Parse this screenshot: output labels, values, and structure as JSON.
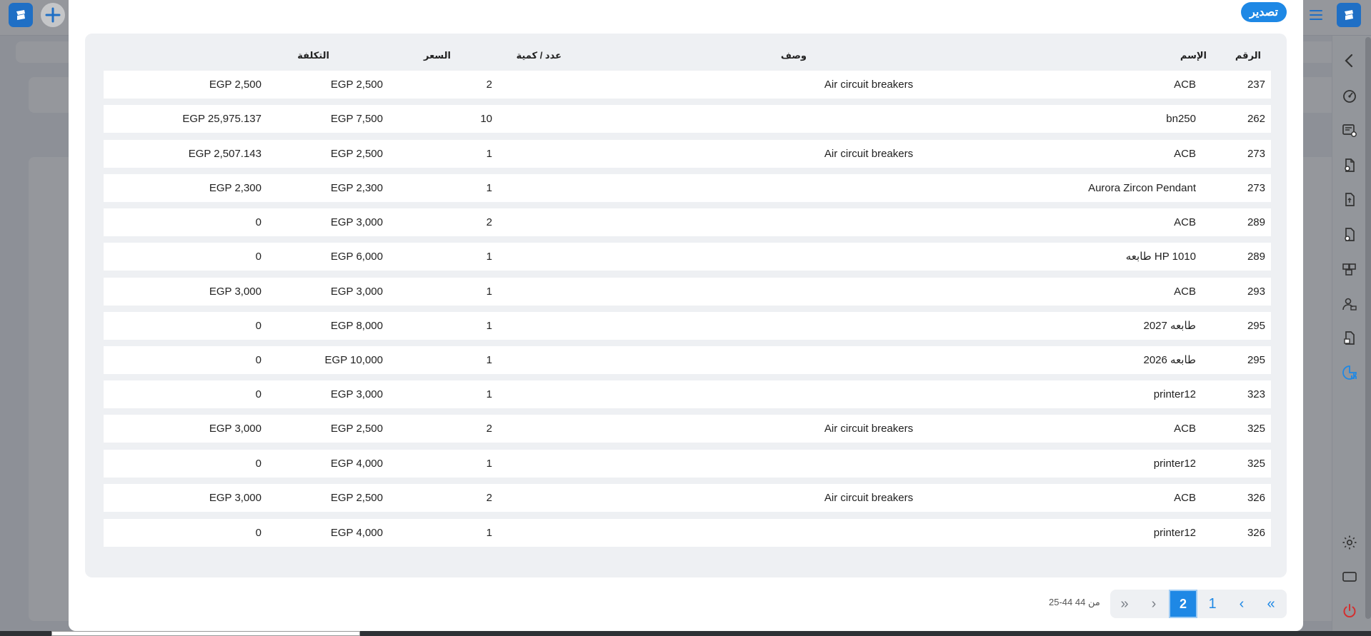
{
  "modal": {
    "export_label": "تصدير",
    "columns": {
      "number": "الرقم",
      "name": "الإسم",
      "description": "وصف",
      "quantity": "عدد / كمية",
      "price": "السعر",
      "cost": "التكلفة"
    },
    "rows": [
      {
        "number": "237",
        "name": "ACB",
        "description": "Air circuit breakers",
        "quantity": "2",
        "price": "EGP 2,500",
        "cost": "EGP 2,500"
      },
      {
        "number": "262",
        "name": "bn250",
        "description": "",
        "quantity": "10",
        "price": "EGP 7,500",
        "cost": "EGP 25,975.137"
      },
      {
        "number": "273",
        "name": "ACB",
        "description": "Air circuit breakers",
        "quantity": "1",
        "price": "EGP 2,500",
        "cost": "EGP 2,507.143"
      },
      {
        "number": "273",
        "name": "Aurora Zircon Pendant",
        "description": "",
        "quantity": "1",
        "price": "EGP 2,300",
        "cost": "EGP 2,300"
      },
      {
        "number": "289",
        "name": "ACB",
        "description": "",
        "quantity": "2",
        "price": "EGP 3,000",
        "cost": "0"
      },
      {
        "number": "289",
        "name": "طابعه HP 1010",
        "description": "",
        "quantity": "1",
        "price": "EGP 6,000",
        "cost": "0"
      },
      {
        "number": "293",
        "name": "ACB",
        "description": "",
        "quantity": "1",
        "price": "EGP 3,000",
        "cost": "EGP 3,000"
      },
      {
        "number": "295",
        "name": "طابعه 2027",
        "description": "",
        "quantity": "1",
        "price": "EGP 8,000",
        "cost": "0"
      },
      {
        "number": "295",
        "name": "طابعه 2026",
        "description": "",
        "quantity": "1",
        "price": "EGP 10,000",
        "cost": "0"
      },
      {
        "number": "323",
        "name": "printer12",
        "description": "",
        "quantity": "1",
        "price": "EGP 3,000",
        "cost": "0"
      },
      {
        "number": "325",
        "name": "ACB",
        "description": "Air circuit breakers",
        "quantity": "2",
        "price": "EGP 2,500",
        "cost": "EGP 3,000"
      },
      {
        "number": "325",
        "name": "printer12",
        "description": "",
        "quantity": "1",
        "price": "EGP 4,000",
        "cost": "0"
      },
      {
        "number": "326",
        "name": "ACB",
        "description": "Air circuit breakers",
        "quantity": "2",
        "price": "EGP 2,500",
        "cost": "EGP 3,000"
      },
      {
        "number": "326",
        "name": "printer12",
        "description": "",
        "quantity": "1",
        "price": "EGP 4,000",
        "cost": "0"
      }
    ],
    "pagination": {
      "first_label": "«",
      "prev_label": "‹",
      "page_1": "1",
      "page_2": "2",
      "next_label": "›",
      "last_label": "»",
      "current_page": 2,
      "range_text": "25-44 من 44"
    }
  },
  "colors": {
    "accent": "#1e88e5",
    "brand": "#1f6fc5",
    "logout": "#d32f2f"
  },
  "icons": {
    "top_left": [
      "app-logo-icon",
      "plus-icon"
    ],
    "top_right": [
      "menu-icon",
      "app-logo-icon"
    ],
    "sidebar": [
      "chevron-left-icon",
      "dashboard-icon",
      "sales-register-icon",
      "documents-icon",
      "invoice-icon",
      "returns-icon",
      "inventory-icon",
      "customers-icon",
      "purchase-icon",
      "reports-icon",
      "settings-icon",
      "screen-icon",
      "power-icon"
    ]
  }
}
